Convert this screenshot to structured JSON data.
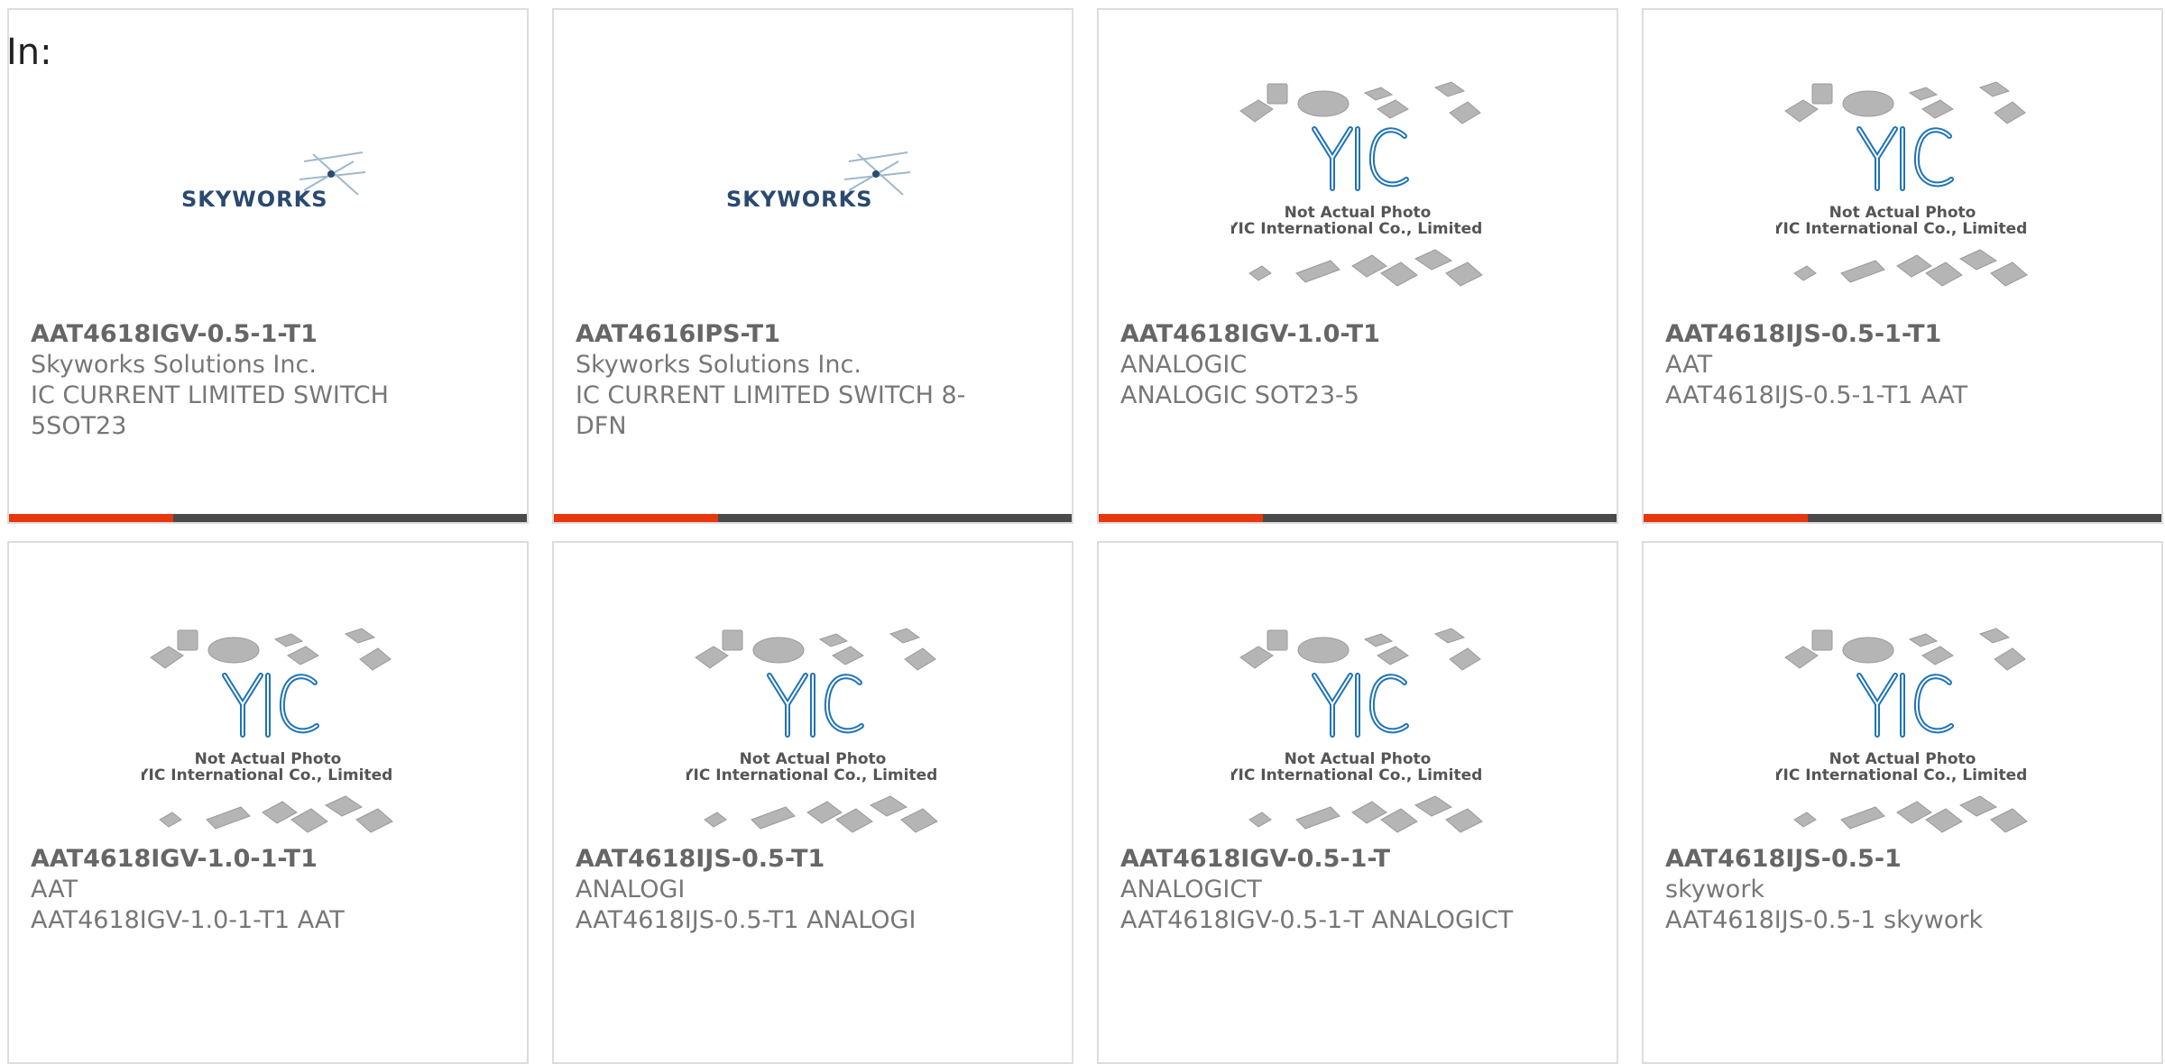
{
  "page": {
    "heading": "In:"
  },
  "colors": {
    "accent": "#e8360e",
    "bar": "#4a4a4a",
    "text": "#777777",
    "border": "#dddddd",
    "yic_blue": "#1f73b7",
    "skyworks_navy": "#2a4a6f"
  },
  "logos": {
    "skyworks": "SKYWORKS",
    "yic_mark": "YIC",
    "yic_line1": "Not Actual Photo",
    "yic_line2": "YIC International Co., Limited."
  },
  "products": [
    {
      "part": "AAT4618IGV-0.5-1-T1",
      "manufacturer": "Skyworks Solutions Inc.",
      "description": "IC CURRENT LIMITED SWITCH 5SOT23",
      "image": "skyworks-logo",
      "has_bar": true
    },
    {
      "part": "AAT4616IPS-T1",
      "manufacturer": "Skyworks Solutions Inc.",
      "description": "IC CURRENT LIMITED SWITCH 8-DFN",
      "image": "skyworks-logo",
      "has_bar": true
    },
    {
      "part": "AAT4618IGV-1.0-T1",
      "manufacturer": "ANALOGIC",
      "description": "ANALOGIC SOT23-5",
      "image": "yic-placeholder",
      "has_bar": true
    },
    {
      "part": "AAT4618IJS-0.5-1-T1",
      "manufacturer": "AAT",
      "description": "AAT4618IJS-0.5-1-T1 AAT",
      "image": "yic-placeholder",
      "has_bar": true
    },
    {
      "part": "AAT4618IGV-1.0-1-T1",
      "manufacturer": "AAT",
      "description": "AAT4618IGV-1.0-1-T1 AAT",
      "image": "yic-placeholder",
      "has_bar": false
    },
    {
      "part": "AAT4618IJS-0.5-T1",
      "manufacturer": "ANALOGI",
      "description": "AAT4618IJS-0.5-T1 ANALOGI",
      "image": "yic-placeholder",
      "has_bar": false
    },
    {
      "part": "AAT4618IGV-0.5-1-T",
      "manufacturer": "ANALOGICT",
      "description": "AAT4618IGV-0.5-1-T ANALOGICT",
      "image": "yic-placeholder",
      "has_bar": false
    },
    {
      "part": "AAT4618IJS-0.5-1",
      "manufacturer": "skywork",
      "description": "AAT4618IJS-0.5-1 skywork",
      "image": "yic-placeholder",
      "has_bar": false
    }
  ]
}
